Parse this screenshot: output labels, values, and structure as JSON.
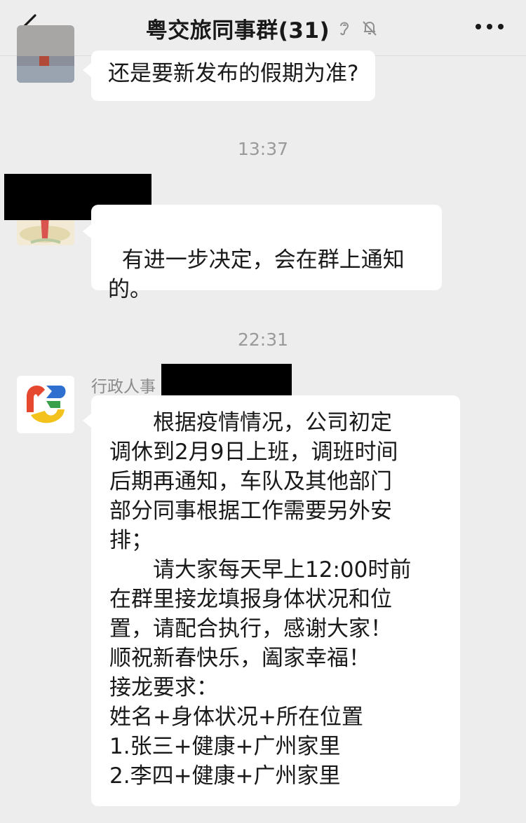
{
  "header": {
    "title": "粤交旅同事群(31)"
  },
  "messages": [
    {
      "text": "还是要新发布的假期为准?"
    },
    {
      "time": "13:37",
      "text": "有进一步决定，会在群上通知\n的。"
    },
    {
      "time": "22:31",
      "sender": "行政人事",
      "lines": [
        "　　根据疫情情况，公司初定",
        "调休到2月9日上班，调班时间",
        "后期再通知，车队及其他部门",
        "部分同事根据工作需要另外安",
        "排；",
        "　　请大家每天早上12:00时前",
        "在群里接龙填报身体状况和位",
        "置，请配合执行，感谢大家！",
        "顺祝新春快乐，阖家幸福！",
        "接龙要求：",
        "姓名+身体状况+所在位置",
        "1.张三+健康+广州家里",
        "2.李四+健康+广州家里"
      ]
    }
  ]
}
